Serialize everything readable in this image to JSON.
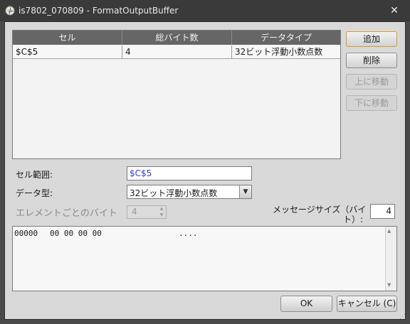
{
  "window": {
    "title": "is7802_070809 - FormatOutputBuffer",
    "close_glyph": "✕",
    "icon": "app-icon"
  },
  "table": {
    "columns": [
      "セル",
      "総バイト数",
      "データタイプ"
    ],
    "rows": [
      [
        "$C$5",
        "4",
        "32ビット浮動小数点数"
      ]
    ]
  },
  "side_buttons": {
    "add": "追加",
    "delete": "削除",
    "move_up": "上に移動",
    "move_down": "下に移動"
  },
  "form": {
    "range_label": "セル範囲:",
    "range_value": "$C$5",
    "type_label": "データ型:",
    "type_value": "32ビット浮動小数点数",
    "per_element_label": "エレメントごとのバイト",
    "per_element_value": "4",
    "msg_size_label_line1": "メッセージサイズ（バイ",
    "msg_size_label_line2": "ト）:",
    "msg_size_value": "4"
  },
  "hex": {
    "offset": "00000",
    "bytes": "00 00 00 00",
    "ascii": "...."
  },
  "buttons": {
    "ok": "OK",
    "cancel": "キャンセル (C)"
  },
  "colors": {
    "accent_border": "#d89b2a",
    "range_text": "#2a3bd8",
    "header_bg": "#666666"
  }
}
